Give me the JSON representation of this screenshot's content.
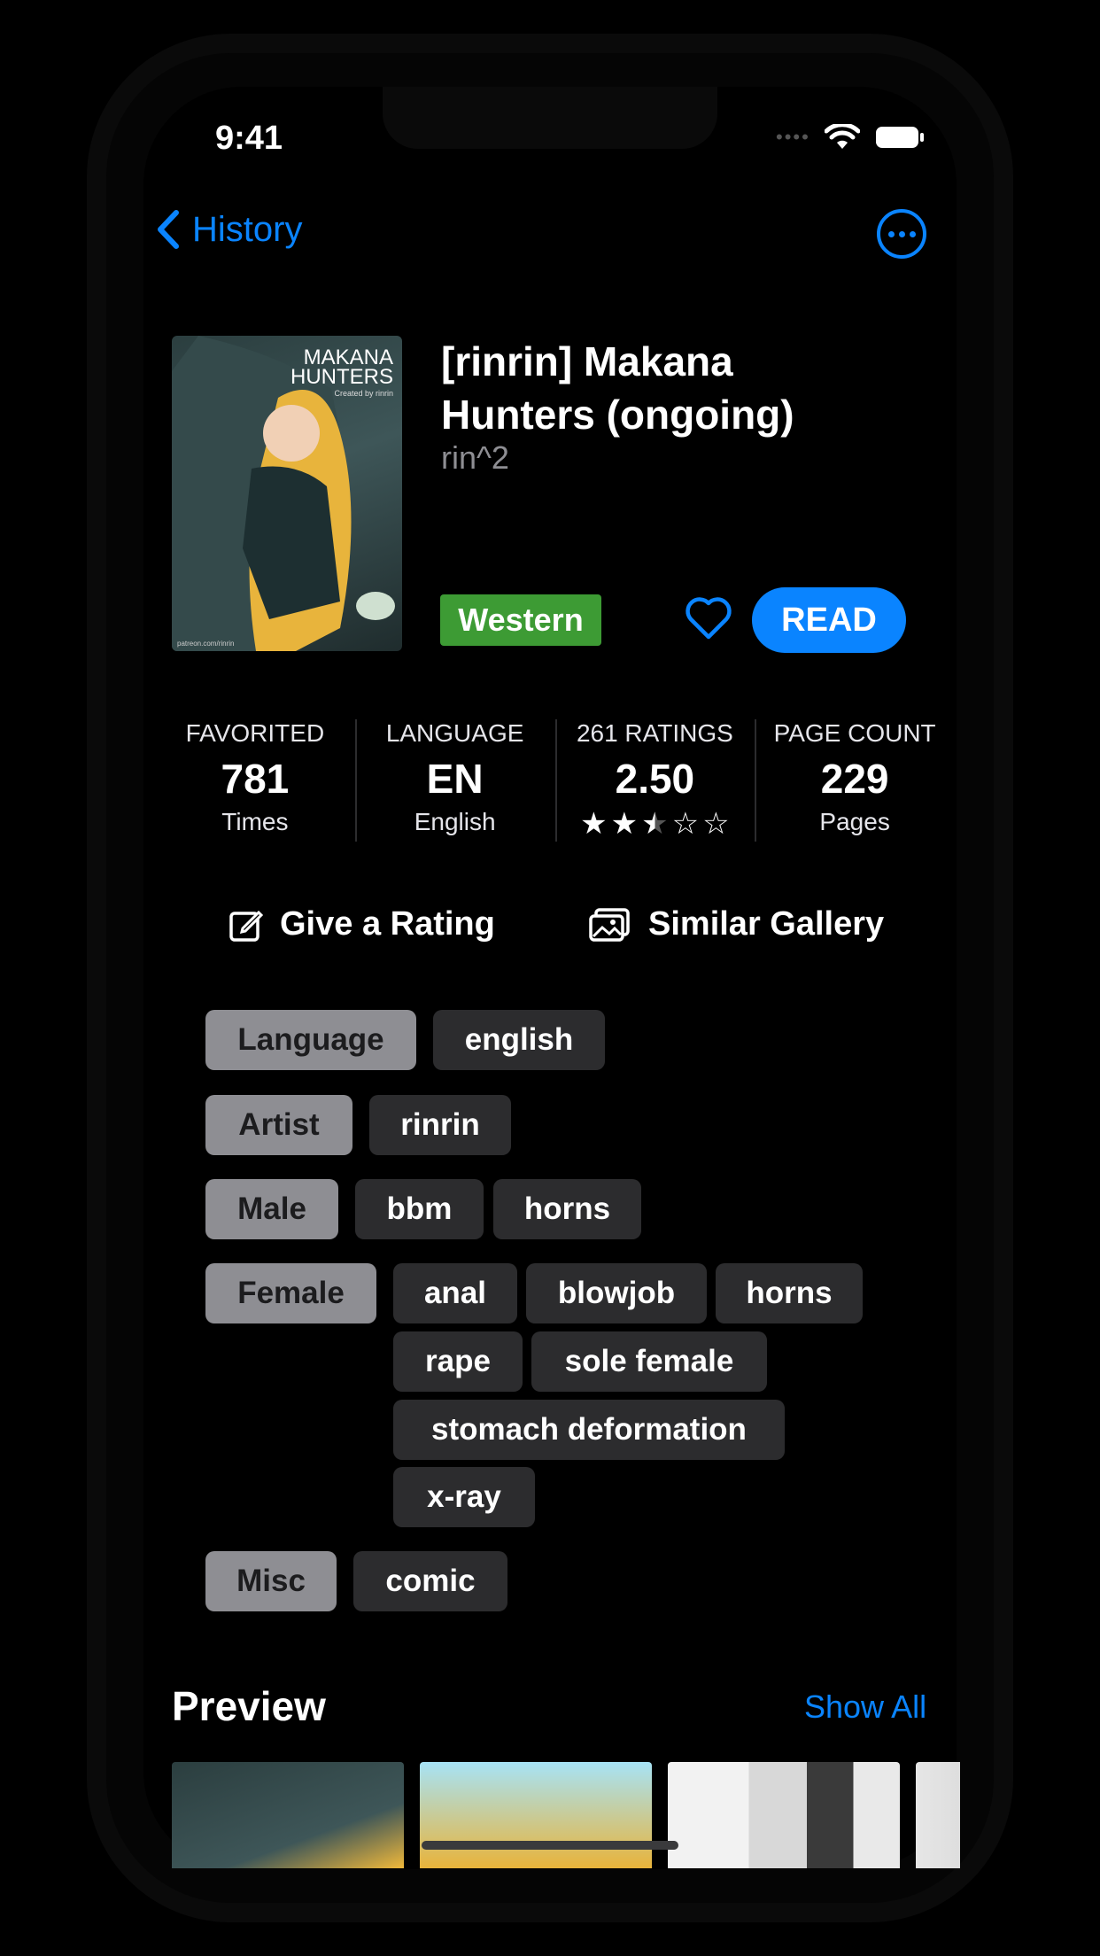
{
  "status_bar": {
    "time": "9:41"
  },
  "nav": {
    "back_label": "History"
  },
  "gallery": {
    "title": "[rinrin] Makana Hunters (ongoing)",
    "uploader": "rin^2",
    "category": "Western",
    "read_label": "READ",
    "cover_text": {
      "line1": "MAKANA",
      "line2": "HUNTERS",
      "line3": "Created by rinrin",
      "footer": "patreon.com/rinrin"
    }
  },
  "stats": {
    "favorited": {
      "label": "FAVORITED",
      "value": "781",
      "sub": "Times"
    },
    "language": {
      "label": "LANGUAGE",
      "value": "EN",
      "sub": "English"
    },
    "ratings": {
      "label": "261 RATINGS",
      "value": "2.50",
      "stars": 2.5
    },
    "pages": {
      "label": "PAGE COUNT",
      "value": "229",
      "sub": "Pages"
    }
  },
  "actions": {
    "rate": "Give a Rating",
    "similar": "Similar Gallery"
  },
  "tags": {
    "language": {
      "ns": "Language",
      "values": [
        "english"
      ]
    },
    "artist": {
      "ns": "Artist",
      "values": [
        "rinrin"
      ]
    },
    "male": {
      "ns": "Male",
      "values": [
        "bbm",
        "horns"
      ]
    },
    "female": {
      "ns": "Female",
      "values": [
        "anal",
        "blowjob",
        "horns",
        "rape",
        "sole female",
        "stomach deformation",
        "x-ray"
      ]
    },
    "misc": {
      "ns": "Misc",
      "values": [
        "comic"
      ]
    }
  },
  "preview": {
    "title": "Preview",
    "show_all": "Show All"
  },
  "colors": {
    "accent": "#0a84ff",
    "category_western": "#3d9b34",
    "tag_namespace": "#8e8e93",
    "tag_value": "#2c2c2e"
  }
}
